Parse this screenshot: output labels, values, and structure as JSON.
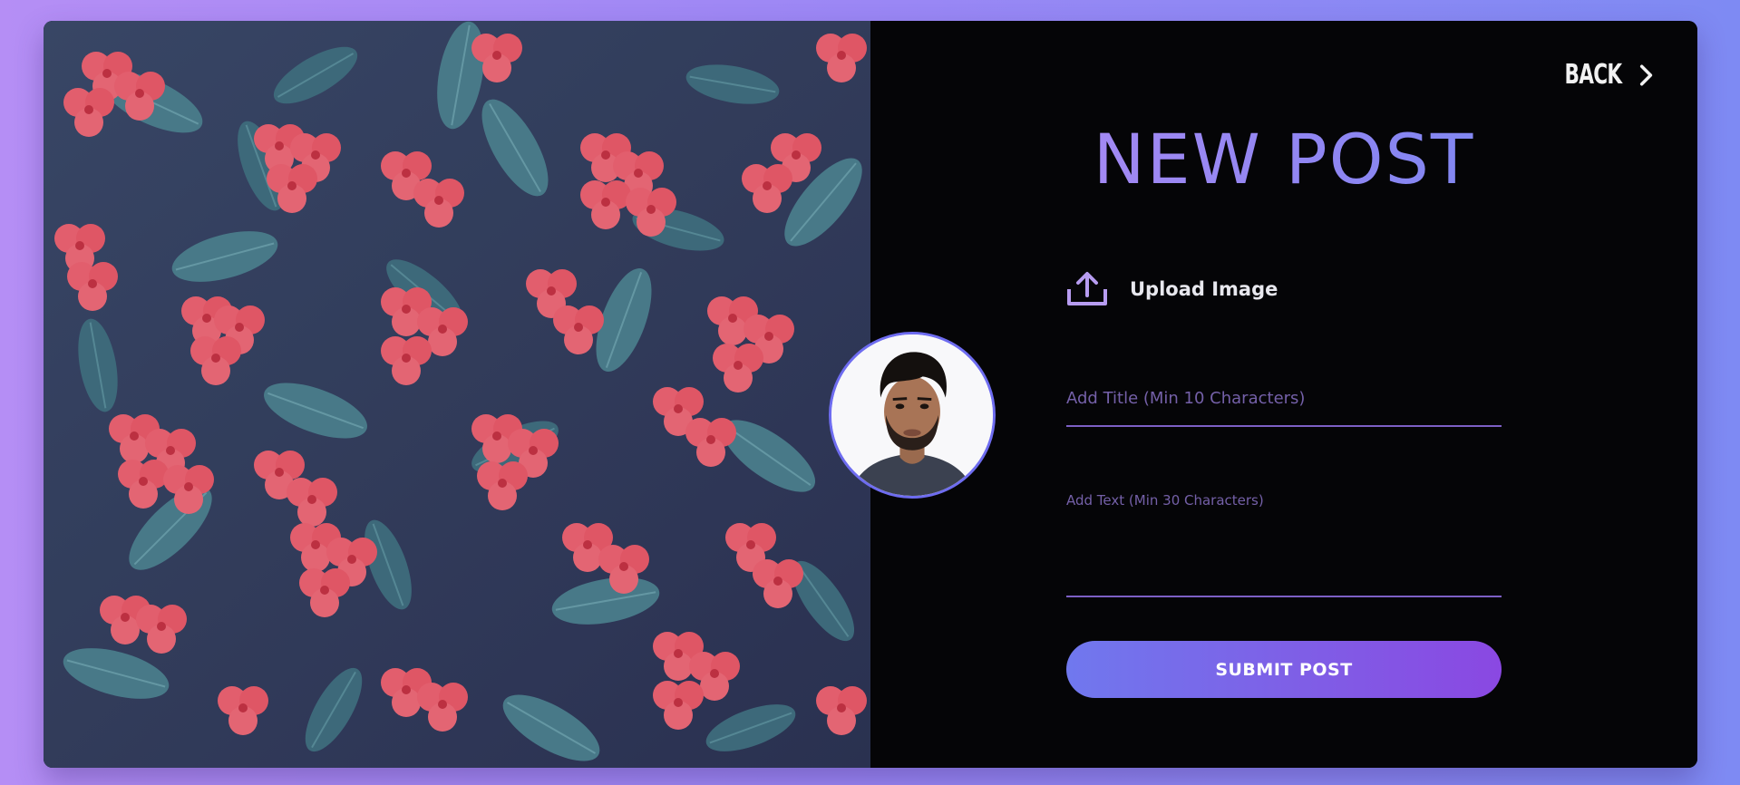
{
  "header": {
    "back_label": "BACK",
    "title": "NEW POST"
  },
  "upload": {
    "label": "Upload Image",
    "icon": "upload-icon"
  },
  "form": {
    "title_placeholder": "Add Title (Min 10 Characters)",
    "title_value": "",
    "text_placeholder": "Add Text (Min 30 Characters)",
    "text_value": "",
    "submit_label": "SUBMIT POST"
  },
  "icons": {
    "back": "chevron-right-icon",
    "upload": "upload-icon"
  },
  "colors": {
    "accent_start": "#b58cf5",
    "accent_end": "#6d88f0",
    "button_start": "#7078ee",
    "button_end": "#8a48e2",
    "panel_background": "#050507"
  }
}
